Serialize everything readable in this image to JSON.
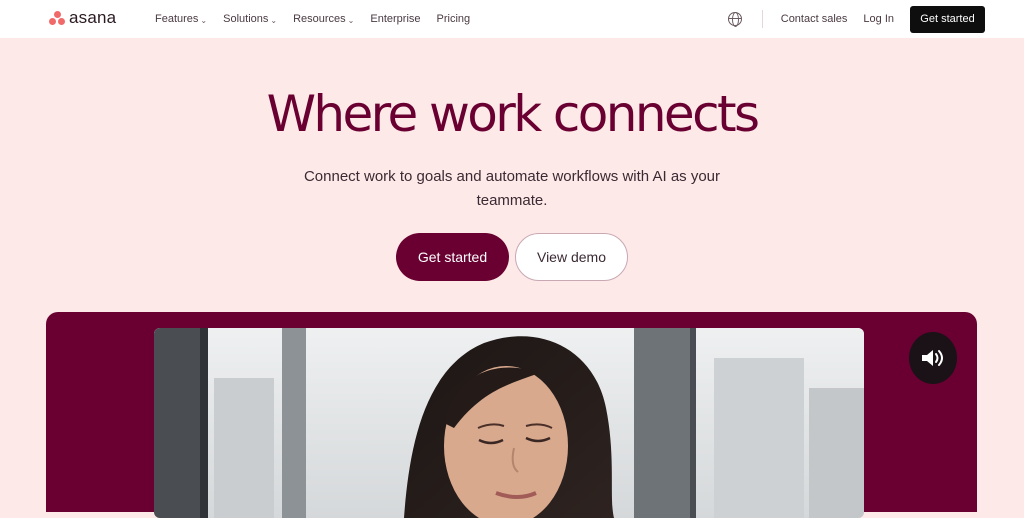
{
  "brand": {
    "name": "asana",
    "logo_color": "#f06a6a"
  },
  "nav": {
    "links": [
      {
        "label": "Features",
        "has_dropdown": true
      },
      {
        "label": "Solutions",
        "has_dropdown": true
      },
      {
        "label": "Resources",
        "has_dropdown": true
      },
      {
        "label": "Enterprise",
        "has_dropdown": false
      },
      {
        "label": "Pricing",
        "has_dropdown": false
      }
    ],
    "language_icon": "globe-icon",
    "contact_sales": "Contact sales",
    "login": "Log In",
    "cta": "Get started"
  },
  "hero": {
    "title": "Where work connects",
    "subtitle_line1": "Connect work to goals and automate workflows with AI as your",
    "subtitle_line2": "teammate.",
    "primary_cta": "Get started",
    "secondary_cta": "View demo"
  },
  "video": {
    "sound_icon": "speaker-volume-icon",
    "accent_color": "#690031"
  }
}
